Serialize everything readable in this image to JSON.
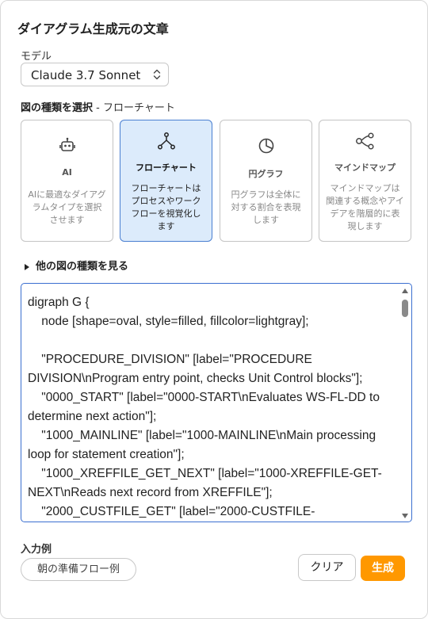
{
  "panel": {
    "title": "ダイアグラム生成元の文章"
  },
  "model": {
    "label": "モデル",
    "selected": "Claude 3.7 Sonnet"
  },
  "diagram_select": {
    "heading_bold": "図の種類を選択",
    "heading_rest": " - フローチャート",
    "cards": [
      {
        "name": "AI",
        "icon": "robot-icon",
        "desc": [
          "AIに最適なダイアグ",
          "ラムタイプを選択",
          "させます"
        ]
      },
      {
        "name": "フローチャート",
        "icon": "flowchart-icon",
        "desc": [
          "フローチャートは",
          "プロセスやワーク",
          "フローを視覚化し",
          "ます"
        ]
      },
      {
        "name": "円グラフ",
        "icon": "pie-chart-icon",
        "desc": [
          "円グラフは全体に",
          "対する割合を表現",
          "します"
        ]
      },
      {
        "name": "マインドマップ",
        "icon": "mindmap-icon",
        "desc": [
          "マインドマップは",
          "関連する概念やアイ",
          "デアを階層的に表",
          "現します"
        ]
      }
    ],
    "more_label": "他の図の種類を見る"
  },
  "editor": {
    "text": "digraph G {\n    node [shape=oval, style=filled, fillcolor=lightgray];\n\n    \"PROCEDURE_DIVISION\" [label=\"PROCEDURE DIVISION\\nProgram entry point, checks Unit Control blocks\"];\n    \"0000_START\" [label=\"0000-START\\nEvaluates WS-FL-DD to determine next action\"];\n    \"1000_MAINLINE\" [label=\"1000-MAINLINE\\nMain processing loop for statement creation\"];\n    \"1000_XREFFILE_GET_NEXT\" [label=\"1000-XREFFILE-GET-NEXT\\nReads next record from XREFFILE\"];\n    \"2000_CUSTFILE_GET\" [label=\"2000-CUSTFILE-"
  },
  "examples": {
    "label": "入力例",
    "items": [
      "朝の準備フロー例"
    ]
  },
  "actions": {
    "clear": "クリア",
    "generate": "生成"
  },
  "colors": {
    "accent": "#ff9800",
    "selected_bg": "#dcebfb",
    "selected_border": "#4a7fd1",
    "editor_border": "#3b6fd0"
  }
}
